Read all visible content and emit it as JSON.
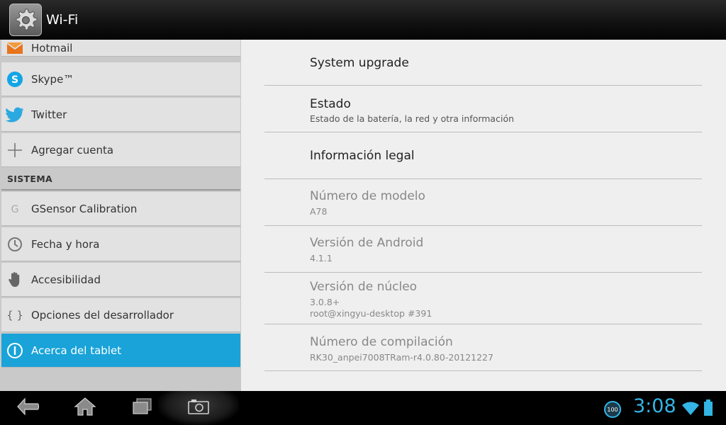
{
  "actionbar": {
    "title": "Wi-Fi",
    "icon": "gear-icon"
  },
  "accounts": [
    {
      "label": "Hotmail",
      "icon": "hotmail-envelope-icon"
    },
    {
      "label": "Skype™",
      "icon": "skype-icon"
    },
    {
      "label": "Twitter",
      "icon": "twitter-bird-icon"
    },
    {
      "label": "Agregar cuenta",
      "icon": "plus-icon"
    }
  ],
  "system_section": {
    "header": "SISTEMA",
    "items": [
      {
        "label": "GSensor Calibration",
        "icon": "g-icon"
      },
      {
        "label": "Fecha y hora",
        "icon": "clock-icon"
      },
      {
        "label": "Accesibilidad",
        "icon": "hand-icon"
      },
      {
        "label": "Opciones del desarrollador",
        "icon": "braces-icon"
      },
      {
        "label": "Acerca del tablet",
        "icon": "info-icon",
        "selected": true
      }
    ]
  },
  "about": {
    "system_upgrade": {
      "title": "System upgrade"
    },
    "status": {
      "title": "Estado",
      "summary": "Estado de la batería, la red y otra información"
    },
    "legal": {
      "title": "Información legal"
    },
    "model": {
      "title": "Número de modelo",
      "summary": "A78"
    },
    "android_version": {
      "title": "Versión de Android",
      "summary": "4.1.1"
    },
    "kernel": {
      "title": "Versión de núcleo",
      "summary_line1": "3.0.8+",
      "summary_line2": "root@xingyu-desktop #391"
    },
    "build": {
      "title": "Número de compilación",
      "summary": "RK30_anpei7008TRam-r4.0.80-20121227"
    }
  },
  "navbar": {
    "back_icon": "back-icon",
    "home_icon": "home-icon",
    "recents_icon": "recent-apps-icon",
    "screenshot_icon": "camera-icon"
  },
  "status": {
    "battery_badge": "100",
    "clock": "3:08",
    "accent_color": "#33b5e5"
  }
}
